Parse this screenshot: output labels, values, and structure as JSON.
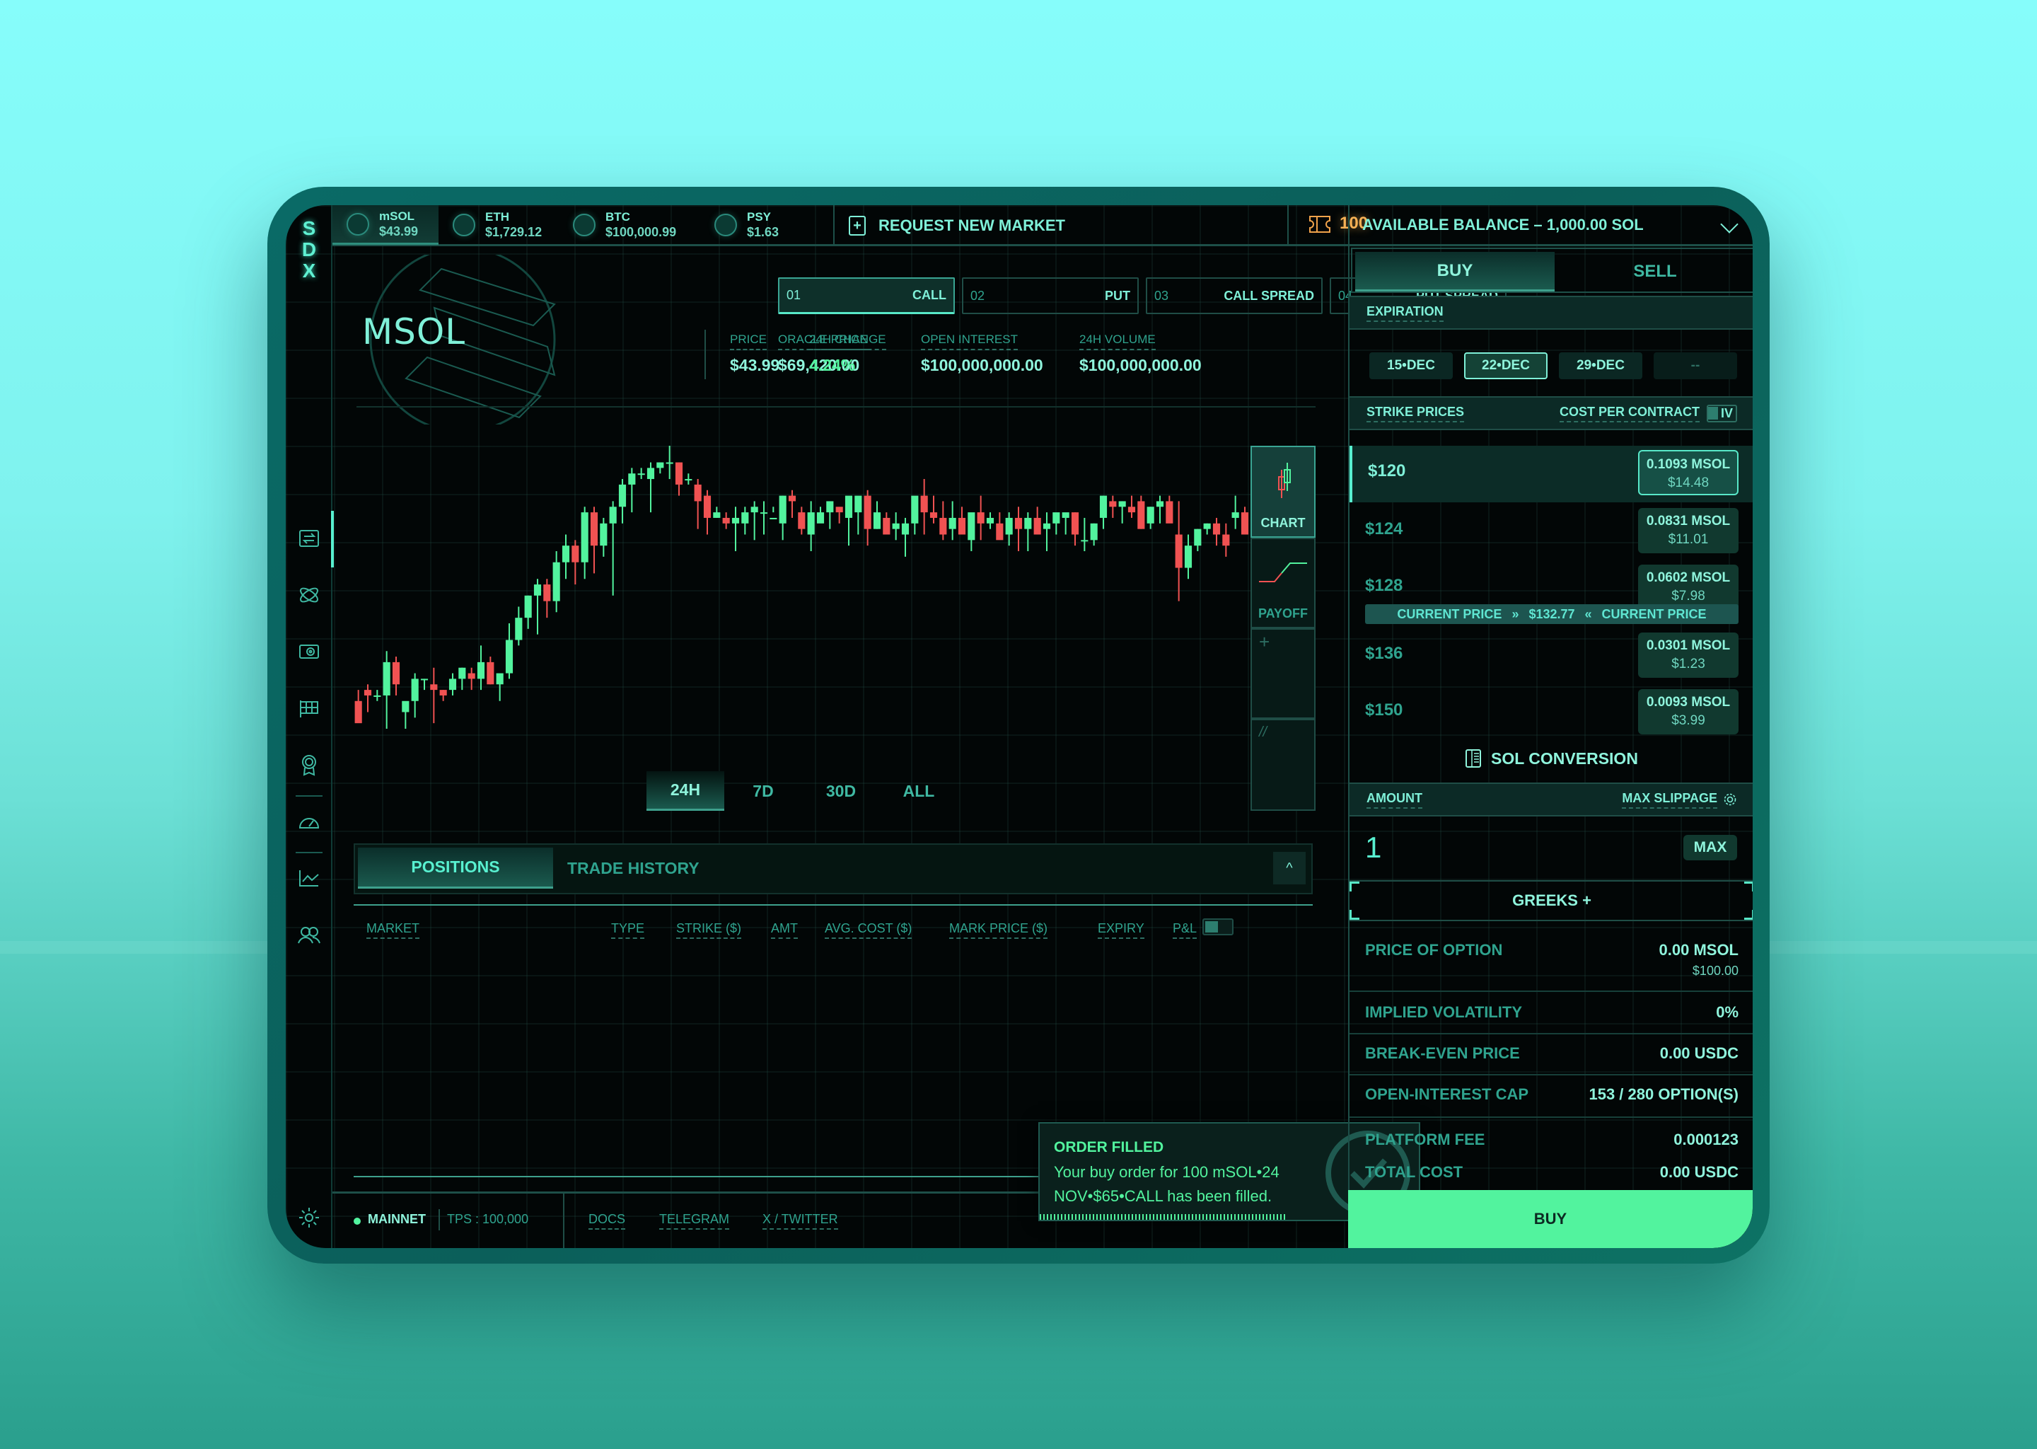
{
  "app": {
    "logo": "SDX"
  },
  "ticker": [
    {
      "symbol": "mSOL",
      "price": "$43.99",
      "active": true
    },
    {
      "symbol": "ETH",
      "price": "$1,729.12",
      "active": false
    },
    {
      "symbol": "BTC",
      "price": "$100,000.99",
      "active": false
    },
    {
      "symbol": "PSY",
      "price": "$1.63",
      "active": false
    }
  ],
  "header": {
    "request_market": "REQUEST NEW MARKET",
    "tickets_count": "100",
    "available_balance": "AVAILABLE BALANCE – 1,000.00 SOL"
  },
  "sidebar": {
    "icons": [
      "swap-icon",
      "atom-icon",
      "vault-icon",
      "flag-icon",
      "award-icon",
      "gauge-icon",
      "line-chart-icon",
      "users-icon"
    ],
    "settings": "settings-icon"
  },
  "market": {
    "name": "MSOL",
    "option_types": [
      {
        "num": "01",
        "label": "CALL",
        "selected": true
      },
      {
        "num": "02",
        "label": "PUT",
        "selected": false
      },
      {
        "num": "03",
        "label": "CALL SPREAD",
        "selected": false
      },
      {
        "num": "04",
        "label": "PUT SPREAD",
        "selected": false
      }
    ],
    "stats": [
      {
        "label": "ORACLE PRICE",
        "value": "$69,420.00"
      },
      {
        "label": "PRICE",
        "value": "$43.99"
      },
      {
        "label": "24H CHANGE",
        "value": "4.24%"
      },
      {
        "label": "OPEN INTEREST",
        "value": "$100,000,000.00"
      },
      {
        "label": "24H VOLUME",
        "value": "$100,000,000.00"
      }
    ]
  },
  "chart": {
    "timeframes": [
      "24H",
      "7D",
      "30D",
      "ALL"
    ],
    "selected_timeframe": "24H",
    "view_tools": [
      {
        "label": "CHART",
        "selected": true
      },
      {
        "label": "PAYOFF",
        "selected": false
      },
      {
        "label": "+",
        "selected": false
      },
      {
        "label": "//",
        "selected": false
      }
    ],
    "colors": {
      "up": "#52f39e",
      "down": "#f05252"
    }
  },
  "chart_data": {
    "type": "candlestick",
    "title": "",
    "xlabel": "",
    "ylabel": "",
    "grid": true,
    "candles": [
      [
        40,
        42,
        38,
        36
      ],
      [
        42,
        43,
        38,
        41
      ],
      [
        41,
        42,
        40,
        41
      ],
      [
        41,
        49,
        35,
        47
      ],
      [
        47,
        48,
        41,
        43
      ],
      [
        38,
        39,
        35,
        40
      ],
      [
        40,
        45,
        37,
        44
      ],
      [
        44,
        44,
        42,
        44
      ],
      [
        43,
        46,
        36,
        42
      ],
      [
        42,
        42,
        40,
        41
      ],
      [
        42,
        45,
        41,
        44
      ],
      [
        44,
        46,
        42,
        46
      ],
      [
        45,
        46,
        42,
        44
      ],
      [
        44,
        50,
        42,
        47
      ],
      [
        47,
        48,
        43,
        43
      ],
      [
        43,
        44,
        40,
        45
      ],
      [
        45,
        54,
        44,
        51
      ],
      [
        51,
        57,
        50,
        55
      ],
      [
        55,
        59,
        53,
        59
      ],
      [
        59,
        62,
        52,
        61
      ],
      [
        61,
        62,
        55,
        58
      ],
      [
        58,
        67,
        56,
        65
      ],
      [
        65,
        70,
        62,
        68
      ],
      [
        68,
        69,
        61,
        65
      ],
      [
        65,
        75,
        62,
        74
      ],
      [
        74,
        75,
        63,
        68
      ],
      [
        68,
        73,
        66,
        72
      ],
      [
        72,
        76,
        59,
        75
      ],
      [
        75,
        80,
        72,
        79
      ],
      [
        79,
        82,
        74,
        81
      ],
      [
        81,
        82,
        80,
        81
      ],
      [
        80,
        83,
        74,
        82
      ],
      [
        82,
        83,
        81,
        83
      ],
      [
        83,
        86,
        80,
        83
      ],
      [
        83,
        83,
        77,
        79
      ],
      [
        80,
        81,
        79,
        80
      ],
      [
        79,
        80,
        71,
        76
      ],
      [
        77,
        78,
        70,
        73
      ],
      [
        73,
        75,
        73,
        74
      ],
      [
        73,
        74,
        71,
        72
      ],
      [
        72,
        75,
        67,
        73
      ],
      [
        72,
        75,
        70,
        74
      ],
      [
        74,
        76,
        69,
        75
      ],
      [
        74,
        76,
        70,
        74
      ],
      [
        73,
        75,
        74,
        73
      ],
      [
        72,
        77,
        69,
        77
      ],
      [
        77,
        78,
        73,
        76
      ],
      [
        74,
        75,
        70,
        71
      ],
      [
        70,
        76,
        67,
        74
      ],
      [
        72,
        75,
        73,
        74
      ],
      [
        74,
        75,
        71,
        76
      ],
      [
        75,
        74,
        72,
        74
      ],
      [
        73,
        75,
        68,
        77
      ],
      [
        74,
        76,
        70,
        77
      ],
      [
        77,
        78,
        68,
        71
      ],
      [
        71,
        76,
        71,
        74
      ],
      [
        73,
        74,
        71,
        70
      ],
      [
        71,
        74,
        69,
        72
      ],
      [
        70,
        73,
        66,
        72
      ],
      [
        72,
        73,
        70,
        77
      ],
      [
        77,
        80,
        70,
        74
      ],
      [
        74,
        77,
        72,
        73
      ],
      [
        73,
        76,
        69,
        70
      ],
      [
        71,
        76,
        69,
        73
      ],
      [
        73,
        75,
        71,
        70
      ],
      [
        69,
        73,
        67,
        74
      ],
      [
        74,
        77,
        69,
        72
      ],
      [
        72,
        74,
        71,
        73
      ],
      [
        72,
        74,
        70,
        69
      ],
      [
        70,
        74,
        68,
        73
      ],
      [
        73,
        75,
        67,
        71
      ],
      [
        71,
        74,
        67,
        73
      ],
      [
        73,
        75,
        70,
        70
      ],
      [
        71,
        74,
        67,
        72
      ],
      [
        72,
        73,
        70,
        74
      ],
      [
        73,
        73,
        70,
        74
      ],
      [
        74,
        74,
        68,
        70
      ],
      [
        69,
        73,
        67,
        69
      ],
      [
        69,
        72,
        68,
        72
      ],
      [
        73,
        77,
        71,
        77
      ],
      [
        76,
        77,
        73,
        75
      ],
      [
        75,
        76,
        72,
        76
      ],
      [
        75,
        77,
        73,
        74
      ],
      [
        76,
        77,
        71,
        71
      ],
      [
        72,
        75,
        71,
        75
      ],
      [
        75,
        77,
        72,
        76
      ],
      [
        76,
        77,
        73,
        72
      ],
      [
        70,
        76,
        58,
        64
      ],
      [
        64,
        70,
        62,
        68
      ],
      [
        68,
        71,
        67,
        71
      ],
      [
        71,
        72,
        70,
        72
      ],
      [
        72,
        73,
        68,
        70
      ],
      [
        70,
        72,
        66,
        68
      ],
      [
        73,
        77,
        71,
        74
      ],
      [
        74,
        75,
        70,
        70
      ],
      [
        71,
        72,
        69,
        68
      ]
    ],
    "candle_format": "[open, high, low, close]"
  },
  "positions": {
    "tabs": [
      "POSITIONS",
      "TRADE HISTORY"
    ],
    "selected_tab": "POSITIONS",
    "columns": [
      "MARKET",
      "TYPE",
      "STRIKE ($)",
      "AMT",
      "AVG. COST ($)",
      "MARK PRICE ($)",
      "EXPIRY",
      "P&L"
    ],
    "rows": []
  },
  "footer": {
    "network": "MAINNET",
    "tps": "TPS : 100,000",
    "links": [
      "DOCS",
      "TELEGRAM",
      "X / TWITTER"
    ]
  },
  "toast": {
    "title": "ORDER FILLED",
    "body": "Your buy order for 100 mSOL•24 NOV•$65•CALL has been filled.",
    "progress": 0.65
  },
  "trade": {
    "side_tabs": [
      "BUY",
      "SELL"
    ],
    "selected_side": "BUY",
    "expiration_label": "EXPIRATION",
    "expirations": [
      {
        "label": "15•DEC",
        "selected": false
      },
      {
        "label": "22•DEC",
        "selected": true
      },
      {
        "label": "29•DEC",
        "selected": false
      },
      {
        "label": "--",
        "selected": false
      }
    ],
    "strike_header": "STRIKE PRICES",
    "cost_header": "COST PER CONTRACT",
    "iv_toggle": "IV",
    "strikes": [
      {
        "strike": "$120",
        "msol": "0.1093 MSOL",
        "usd": "$14.48",
        "selected": true
      },
      {
        "strike": "$124",
        "msol": "0.0831 MSOL",
        "usd": "$11.01",
        "selected": false
      },
      {
        "strike": "$128",
        "msol": "0.0602 MSOL",
        "usd": "$7.98",
        "selected": false
      },
      {
        "strike": "$136",
        "msol": "0.0301 MSOL",
        "usd": "$1.23",
        "selected": false
      },
      {
        "strike": "$150",
        "msol": "0.0093 MSOL",
        "usd": "$3.99",
        "selected": false
      }
    ],
    "current_price_label": "CURRENT PRICE",
    "current_price": "$132.77",
    "sol_conversion": "SOL CONVERSION",
    "amount_label": "AMOUNT",
    "max_slippage_label": "MAX SLIPPAGE",
    "amount_value": "1",
    "max_label": "MAX",
    "greeks_label": "GREEKS +",
    "summary": [
      {
        "label": "PRICE OF OPTION",
        "value": "0.00 MSOL",
        "sub": "$100.00"
      },
      {
        "label": "IMPLIED VOLATILITY",
        "value": "0%"
      },
      {
        "label": "BREAK-EVEN PRICE",
        "value": "0.00 USDC"
      },
      {
        "label": "OPEN-INTEREST CAP",
        "value": "153 / 280 OPTION(S)"
      },
      {
        "label": "PLATFORM FEE",
        "value": "0.000123"
      },
      {
        "label": "TOTAL COST",
        "value": "0.00 USDC"
      }
    ],
    "buy_button": "BUY"
  }
}
